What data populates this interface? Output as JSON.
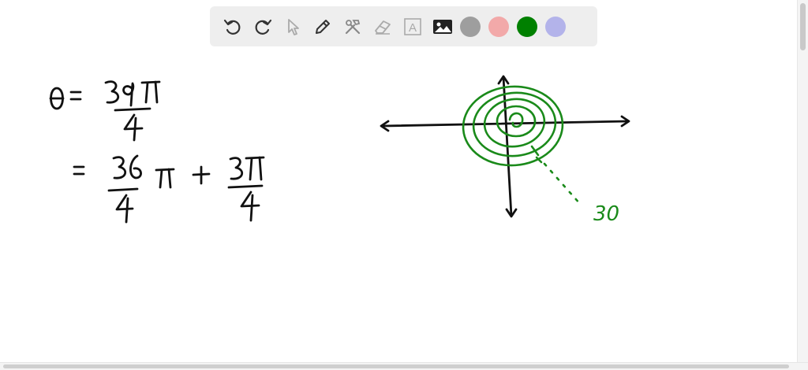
{
  "toolbar": {
    "tools": [
      {
        "name": "undo-icon"
      },
      {
        "name": "redo-icon"
      },
      {
        "name": "pointer-icon"
      },
      {
        "name": "pen-icon"
      },
      {
        "name": "tools-icon"
      },
      {
        "name": "eraser-icon"
      },
      {
        "name": "text-icon",
        "glyph": "A"
      },
      {
        "name": "image-icon"
      }
    ],
    "colors": [
      {
        "name": "gray",
        "hex": "#9e9e9e"
      },
      {
        "name": "pink",
        "hex": "#f2a9a9"
      },
      {
        "name": "green",
        "hex": "#008000"
      },
      {
        "name": "lavender",
        "hex": "#b3b3ea"
      }
    ]
  },
  "whiteboard": {
    "ink_black": "#111111",
    "ink_green": "#1a8a1a",
    "annotation_label": "30"
  }
}
